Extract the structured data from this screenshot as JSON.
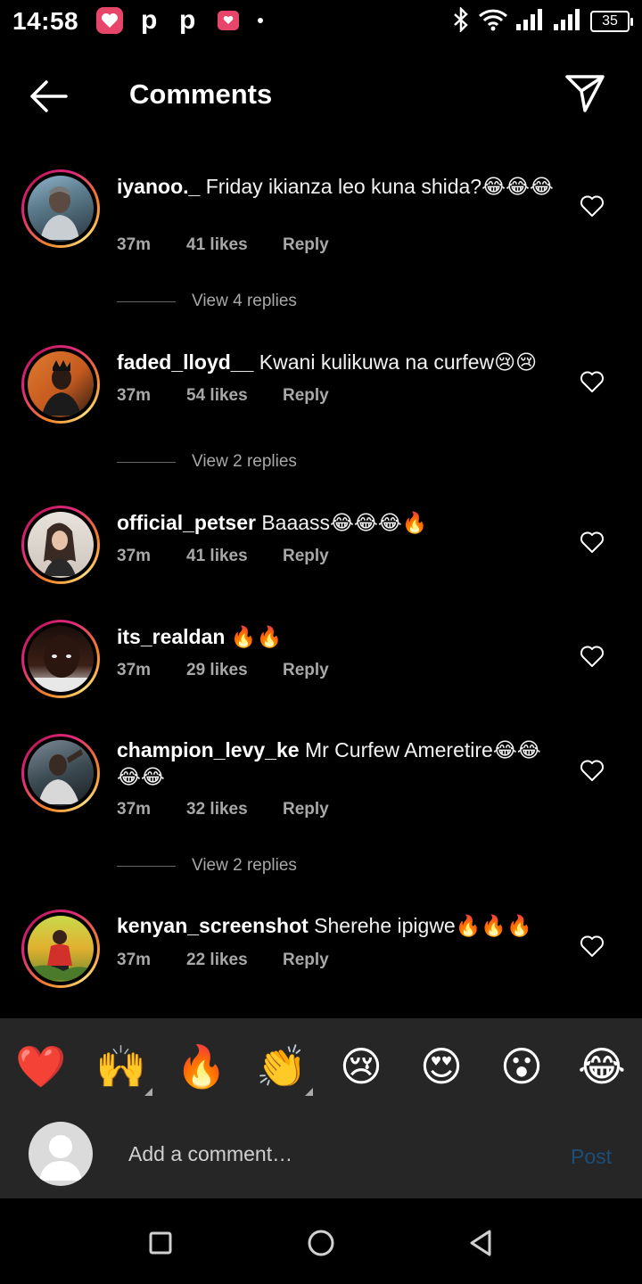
{
  "status_bar": {
    "time": "14:58",
    "notifications": [
      "heart-notification-icon",
      "p-app",
      "p-app",
      "message-notification-icon",
      "more-dot"
    ],
    "notif_p1": "p",
    "notif_p2": "p",
    "battery": "35",
    "icons": [
      "bluetooth-icon",
      "wifi-icon",
      "signal-icon",
      "signal-icon",
      "battery-icon"
    ]
  },
  "header": {
    "title": "Comments"
  },
  "comments": [
    {
      "username": "iyanoo._",
      "text": " Friday ikianza leo kuna shida?😂😂😂",
      "time": "37m",
      "likes": "41 likes",
      "reply": "Reply",
      "view_replies": "View 4 replies"
    },
    {
      "username": "faded_lloyd__",
      "text": " Kwani kulikuwa na curfew😢😢",
      "time": "37m",
      "likes": "54 likes",
      "reply": "Reply",
      "view_replies": "View 2 replies"
    },
    {
      "username": "official_petser",
      "text": " Baaass😂😂😂🔥",
      "time": "37m",
      "likes": "41 likes",
      "reply": "Reply"
    },
    {
      "username": "its_realdan",
      "text": " 🔥🔥",
      "time": "37m",
      "likes": "29 likes",
      "reply": "Reply"
    },
    {
      "username": "champion_levy_ke",
      "text": " Mr Curfew Ameretire😂😂😂😂",
      "time": "37m",
      "likes": "32 likes",
      "reply": "Reply",
      "view_replies": "View 2 replies"
    },
    {
      "username": "kenyan_screenshot",
      "text": " Sherehe ipigwe🔥🔥🔥",
      "time": "37m",
      "likes": "22 likes",
      "reply": "Reply"
    }
  ],
  "emoji_bar": {
    "emojis": [
      "❤️",
      "🙌",
      "🔥",
      "👏",
      "😢",
      "😍",
      "😮",
      "😂"
    ]
  },
  "input": {
    "placeholder": "Add a comment…",
    "post_label": "Post"
  },
  "colors": {
    "background": "#000000",
    "panel": "#262626",
    "secondary_text": "#a8a8a8",
    "post_disabled": "#1b4e78",
    "notification": "#e8456b"
  }
}
